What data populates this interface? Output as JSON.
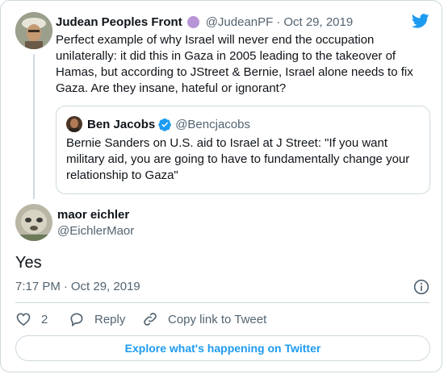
{
  "colors": {
    "brand_blue": "#1d9bf0",
    "muted_text": "#536471",
    "border": "#cfd9de",
    "verified": "#1d9bf0",
    "emoji_purple": "#b794d6"
  },
  "parent_tweet": {
    "display_name": "Judean Peoples Front",
    "emoji": "purple-circle",
    "handle": "@JudeanPF",
    "separator": "·",
    "date": "Oct 29, 2019",
    "text": "Perfect example of why Israel will never end the occupation unilaterally: it did this in Gaza in 2005 leading to the takeover of Hamas, but according to JStreet & Bernie, Israel alone needs to fix Gaza. Are they insane, hateful or ignorant?",
    "quoted_tweet": {
      "display_name": "Ben Jacobs",
      "verified": true,
      "handle": "@Bencjacobs",
      "text": "Bernie Sanders on U.S. aid to Israel at J Street: \"If you want military aid, you are going to have to fundamentally change your relationship to Gaza\""
    }
  },
  "reply_tweet": {
    "display_name": "maor eichler",
    "handle": "@EichlerMaor",
    "text": "Yes",
    "time": "7:17 PM",
    "separator": "·",
    "date": "Oct 29, 2019",
    "actions": {
      "like_count": "2",
      "reply_label": "Reply",
      "copy_link_label": "Copy link to Tweet"
    }
  },
  "explore_button_label": "Explore what's happening on Twitter"
}
